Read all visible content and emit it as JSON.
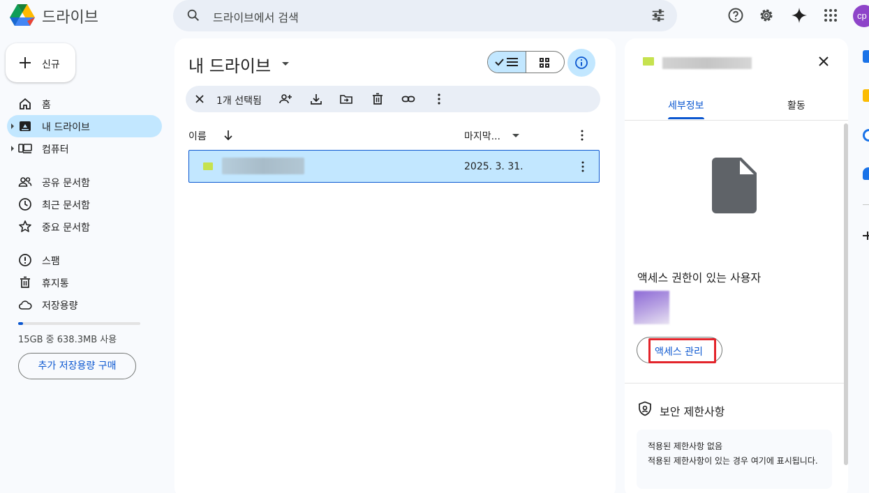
{
  "header": {
    "app_title": "드라이브",
    "search_placeholder": "드라이브에서 검색",
    "avatar_initials": "cp"
  },
  "sidebar": {
    "new_label": "신규",
    "items": [
      {
        "label": "홈",
        "icon": "home-icon"
      },
      {
        "label": "내 드라이브",
        "icon": "drive-icon",
        "active": true
      },
      {
        "label": "컴퓨터",
        "icon": "computer-icon"
      },
      {
        "label": "공유 문서함",
        "icon": "shared-icon"
      },
      {
        "label": "최근 문서함",
        "icon": "clock-icon"
      },
      {
        "label": "중요 문서함",
        "icon": "star-icon"
      },
      {
        "label": "스팸",
        "icon": "spam-icon"
      },
      {
        "label": "휴지통",
        "icon": "trash-icon"
      },
      {
        "label": "저장용량",
        "icon": "cloud-icon"
      }
    ],
    "storage_text": "15GB 중 638.3MB 사용",
    "storage_fraction": 0.042,
    "buy_label": "추가 저장용량 구매"
  },
  "main": {
    "title": "내 드라이브",
    "selection_count": "1개 선택됨",
    "columns": {
      "name": "이름",
      "modified": "마지막..."
    },
    "files": [
      {
        "modified": "2025. 3. 31."
      }
    ]
  },
  "details": {
    "tabs": [
      "세부정보",
      "활동"
    ],
    "access_heading": "액세스 권한이 있는 사용자",
    "manage_label": "액세스 관리",
    "security_heading": "보안 제한사항",
    "security_line1": "적용된 제한사항 없음",
    "security_line2": "적용된 제한사항이 있는 경우 여기에 표시됩니다."
  },
  "colors": {
    "accent": "#0b57d0",
    "selected_bg": "#c2e7ff",
    "highlight_box": "#e3242b",
    "file_icon": "#c6e24f"
  }
}
